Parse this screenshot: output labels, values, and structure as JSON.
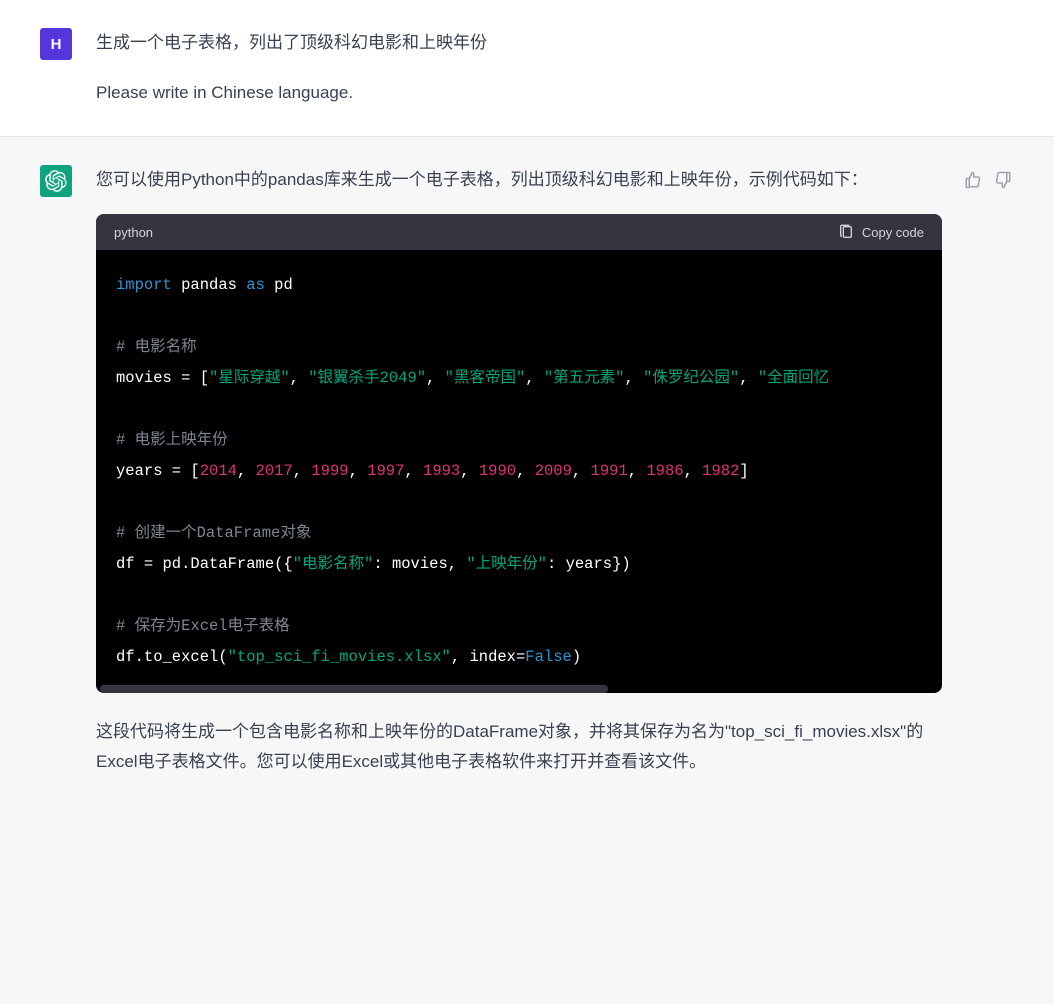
{
  "user": {
    "avatar_letter": "H",
    "line1": "生成一个电子表格，列出了顶级科幻电影和上映年份",
    "line2": "Please write in Chinese language."
  },
  "assistant": {
    "intro": "您可以使用Python中的pandas库来生成一个电子表格，列出顶级科幻电影和上映年份，示例代码如下：",
    "outro": "这段代码将生成一个包含电影名称和上映年份的DataFrame对象，并将其保存为名为\"top_sci_fi_movies.xlsx\"的Excel电子表格文件。您可以使用Excel或其他电子表格软件来打开并查看该文件。"
  },
  "code": {
    "language": "python",
    "copy_label": "Copy code",
    "c_import": "import",
    "c_pandas": " pandas ",
    "c_as": "as",
    "c_pd": " pd",
    "c_comment1": "# 电影名称",
    "c_movies_assign": "movies = [",
    "c_m1": "\"星际穿越\"",
    "c_sep1": ", ",
    "c_m2": "\"银翼杀手2049\"",
    "c_sep2": ", ",
    "c_m3": "\"黑客帝国\"",
    "c_sep3": ", ",
    "c_m4": "\"第五元素\"",
    "c_sep4": ", ",
    "c_m5": "\"侏罗纪公园\"",
    "c_sep5": ", ",
    "c_m6": "\"全面回忆",
    "c_comment2": "# 电影上映年份",
    "c_years_assign": "years = [",
    "c_y1": "2014",
    "c_ys1": ", ",
    "c_y2": "2017",
    "c_ys2": ", ",
    "c_y3": "1999",
    "c_ys3": ", ",
    "c_y4": "1997",
    "c_ys4": ", ",
    "c_y5": "1993",
    "c_ys5": ", ",
    "c_y6": "1990",
    "c_ys6": ", ",
    "c_y7": "2009",
    "c_ys7": ", ",
    "c_y8": "1991",
    "c_ys8": ", ",
    "c_y9": "1986",
    "c_ys9": ", ",
    "c_y10": "1982",
    "c_years_close": "]",
    "c_comment3": "# 创建一个DataFrame对象",
    "c_df_assign": "df = pd.DataFrame({",
    "c_k1": "\"电影名称\"",
    "c_df_mid1": ": movies, ",
    "c_k2": "\"上映年份\"",
    "c_df_end": ": years})",
    "c_comment4": "# 保存为Excel电子表格",
    "c_excel_call": "df.to_excel(",
    "c_filename": "\"top_sci_fi_movies.xlsx\"",
    "c_index_part": ", index=",
    "c_false": "False",
    "c_close_paren": ")"
  }
}
